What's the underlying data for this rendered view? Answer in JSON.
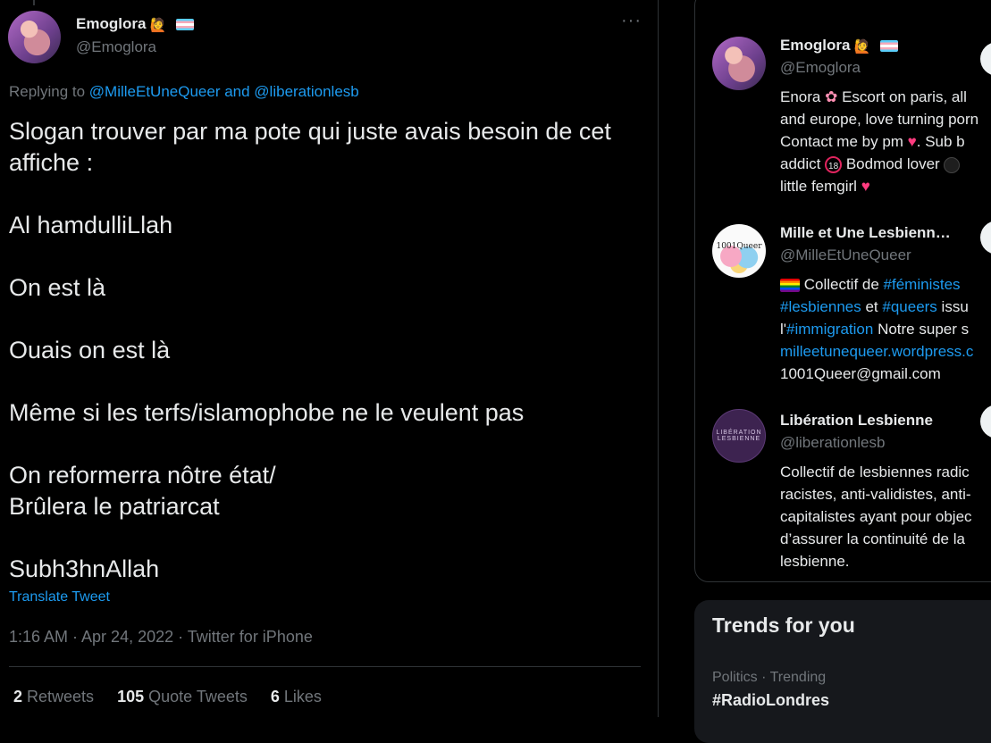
{
  "tweet": {
    "author_name": "Emoglora",
    "author_handle": "@Emoglora",
    "replying_prefix": "Replying to ",
    "replying_to_1": "@MilleEtUneQueer",
    "replying_and": " and ",
    "replying_to_2": "@liberationlesb",
    "lines": {
      "l1": "Slogan trouver par ma pote qui juste avais besoin de cet affiche :",
      "l2": "Al hamdulliLlah",
      "l3": "On est là",
      "l4": "Ouais on est là",
      "l5": "Même si les terfs/islamophobe ne le veulent pas",
      "l6a": "On reformerra nôtre état/",
      "l6b": "Brûlera le patriarcat",
      "l7": "Subh3hnAllah"
    },
    "translate_label": "Translate Tweet",
    "meta": "1:16 AM · Apr 24, 2022 · Twitter for iPhone",
    "stats": {
      "retweets_count": "2",
      "retweets_label": " Retweets",
      "quotes_count": "105",
      "quotes_label": " Quote Tweets",
      "likes_count": "6",
      "likes_label": " Likes"
    }
  },
  "relevant_people": {
    "people": [
      {
        "name": "Emoglora",
        "handle": "@Emoglora",
        "bio_a": "Enora ",
        "bio_b": " Escort on paris, all\nand europe, love turning porn\nContact me by pm ",
        "bio_c": ". Sub b\naddict ",
        "bio_d": " Bodmod lover ",
        "bio_e": "\nlittle femgirl "
      },
      {
        "name": "Mille et Une Lesbienn…",
        "handle": "@MilleEtUneQueer",
        "avatar_text": "1001Queer",
        "bio_a": " Collectif de ",
        "bio_tag1": "#féministes",
        "bio_tag2": "#lesbiennes",
        "bio_et": " et ",
        "bio_tag3": "#queers",
        "bio_issu": " issu",
        "bio_l": "l'",
        "bio_tag4": "#immigration",
        "bio_super": " Notre super s",
        "bio_url": "milleetunequeer.wordpress.c",
        "bio_email": "1001Queer@gmail.com"
      },
      {
        "name": "Libération Lesbienne",
        "handle": "@liberationlesb",
        "avatar_text": "LIBÉRATION LESBIENNE",
        "bio": "Collectif de lesbiennes radic\nracistes, anti-validistes, anti-\ncapitalistes ayant pour objec\nd’assurer la continuité de la\nlesbienne."
      }
    ]
  },
  "trends": {
    "title": "Trends for you",
    "items": [
      {
        "category": "Politics · Trending",
        "name": "#RadioLondres"
      }
    ]
  },
  "icons": {
    "more": "more-horizontal-icon",
    "emoji": "person-emoji-icon",
    "trans_flag": "transgender-flag-icon",
    "rainbow_flag": "rainbow-flag-icon"
  },
  "colors": {
    "accent": "#1d9bf0",
    "text": "#e7e9ea",
    "muted": "#71767b",
    "border": "#2f3336"
  }
}
